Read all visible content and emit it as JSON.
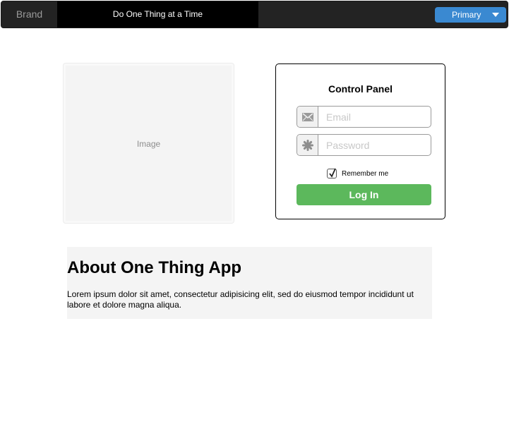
{
  "navbar": {
    "brand": "Brand",
    "active_item": "Do One Thing at a Time",
    "primary_button": "Primary"
  },
  "image": {
    "label": "Image"
  },
  "control_panel": {
    "title": "Control Panel",
    "email_placeholder": "Email",
    "password_placeholder": "Password",
    "remember_label": "Remember me",
    "remember_checked": true,
    "login_button": "Log In"
  },
  "about": {
    "title": "About One Thing App",
    "text": "Lorem ipsum dolor sit amet, consectetur adipisicing elit, sed do eiusmod tempor incididunt ut labore et dolore magna aliqua."
  },
  "icons": {
    "email": "envelope-icon",
    "password": "asterisk-icon",
    "dropdown": "caret-down-icon",
    "check": "checkmark-icon"
  },
  "colors": {
    "navbar_bg": "#232323",
    "nav_active_bg": "#000000",
    "primary_blue": "#3a89d1",
    "login_green": "#5cb85c"
  }
}
